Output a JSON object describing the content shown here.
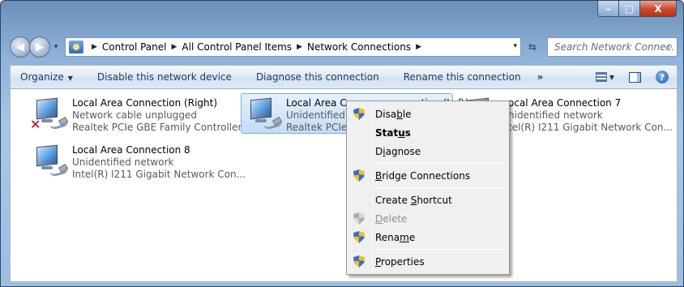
{
  "window": {
    "controls": {
      "minimize": "–",
      "maximize": "□",
      "close": "X"
    }
  },
  "navigation": {
    "back": "◀",
    "forward": "▶",
    "recent": "▾",
    "breadcrumb": [
      "Control Panel",
      "All Control Panel Items",
      "Network Connections"
    ],
    "separator": "▶",
    "dropdown": "▾",
    "refresh": "⇆",
    "search_placeholder": "Search Network Connec...",
    "search_icon": "⌕"
  },
  "commandbar": {
    "organize": "Organize",
    "organize_drop": "▼",
    "disable": "Disable this network device",
    "diagnose": "Diagnose this connection",
    "rename": "Rename this connection",
    "more": "»",
    "view_drop": "▼",
    "help": "?"
  },
  "connections": [
    {
      "name": "Local Area Connection (Right)",
      "status": "Network cable unplugged",
      "device": "Realtek PCIe GBE Family Controller",
      "error": true
    },
    {
      "name": "Local Area Connection (Left)",
      "name_visible": "Local Area Co",
      "name_tail": "ction (Left)",
      "status": "Unidentified",
      "device": "Realtek PCIe",
      "selected": true
    },
    {
      "name": "Local Area Connection 7",
      "name_visible": "ocal Area Connection 7",
      "status": "nidentified network",
      "device": "tel(R) I211 Gigabit Network Con..."
    },
    {
      "name": "Local Area Connection 8",
      "status": "Unidentified network",
      "device": "Intel(R) I211 Gigabit Network Con..."
    }
  ],
  "context_menu": {
    "items": [
      {
        "label_pre": "Disa",
        "label_u": "b",
        "label_post": "le",
        "shield": true,
        "bold": false,
        "disabled": false
      },
      {
        "label_pre": "Stat",
        "label_u": "u",
        "label_post": "s",
        "shield": false,
        "bold": true,
        "disabled": false
      },
      {
        "label_pre": "D",
        "label_u": "i",
        "label_post": "agnose",
        "shield": false,
        "bold": false,
        "disabled": false
      },
      {
        "label_pre": "",
        "label_u": "B",
        "label_post": "ridge Connections",
        "shield": true,
        "bold": false,
        "disabled": false
      },
      {
        "label_pre": "Create ",
        "label_u": "S",
        "label_post": "hortcut",
        "shield": false,
        "bold": false,
        "disabled": false
      },
      {
        "label_pre": "",
        "label_u": "D",
        "label_post": "elete",
        "shield": true,
        "bold": false,
        "disabled": true
      },
      {
        "label_pre": "Rena",
        "label_u": "m",
        "label_post": "e",
        "shield": true,
        "bold": false,
        "disabled": false
      },
      {
        "label_pre": "",
        "label_u": "P",
        "label_post": "roperties",
        "shield": true,
        "bold": false,
        "disabled": false
      }
    ]
  },
  "colors": {
    "accent": "#1e395b",
    "selection": "#c3dcf7",
    "error": "#d00000"
  }
}
